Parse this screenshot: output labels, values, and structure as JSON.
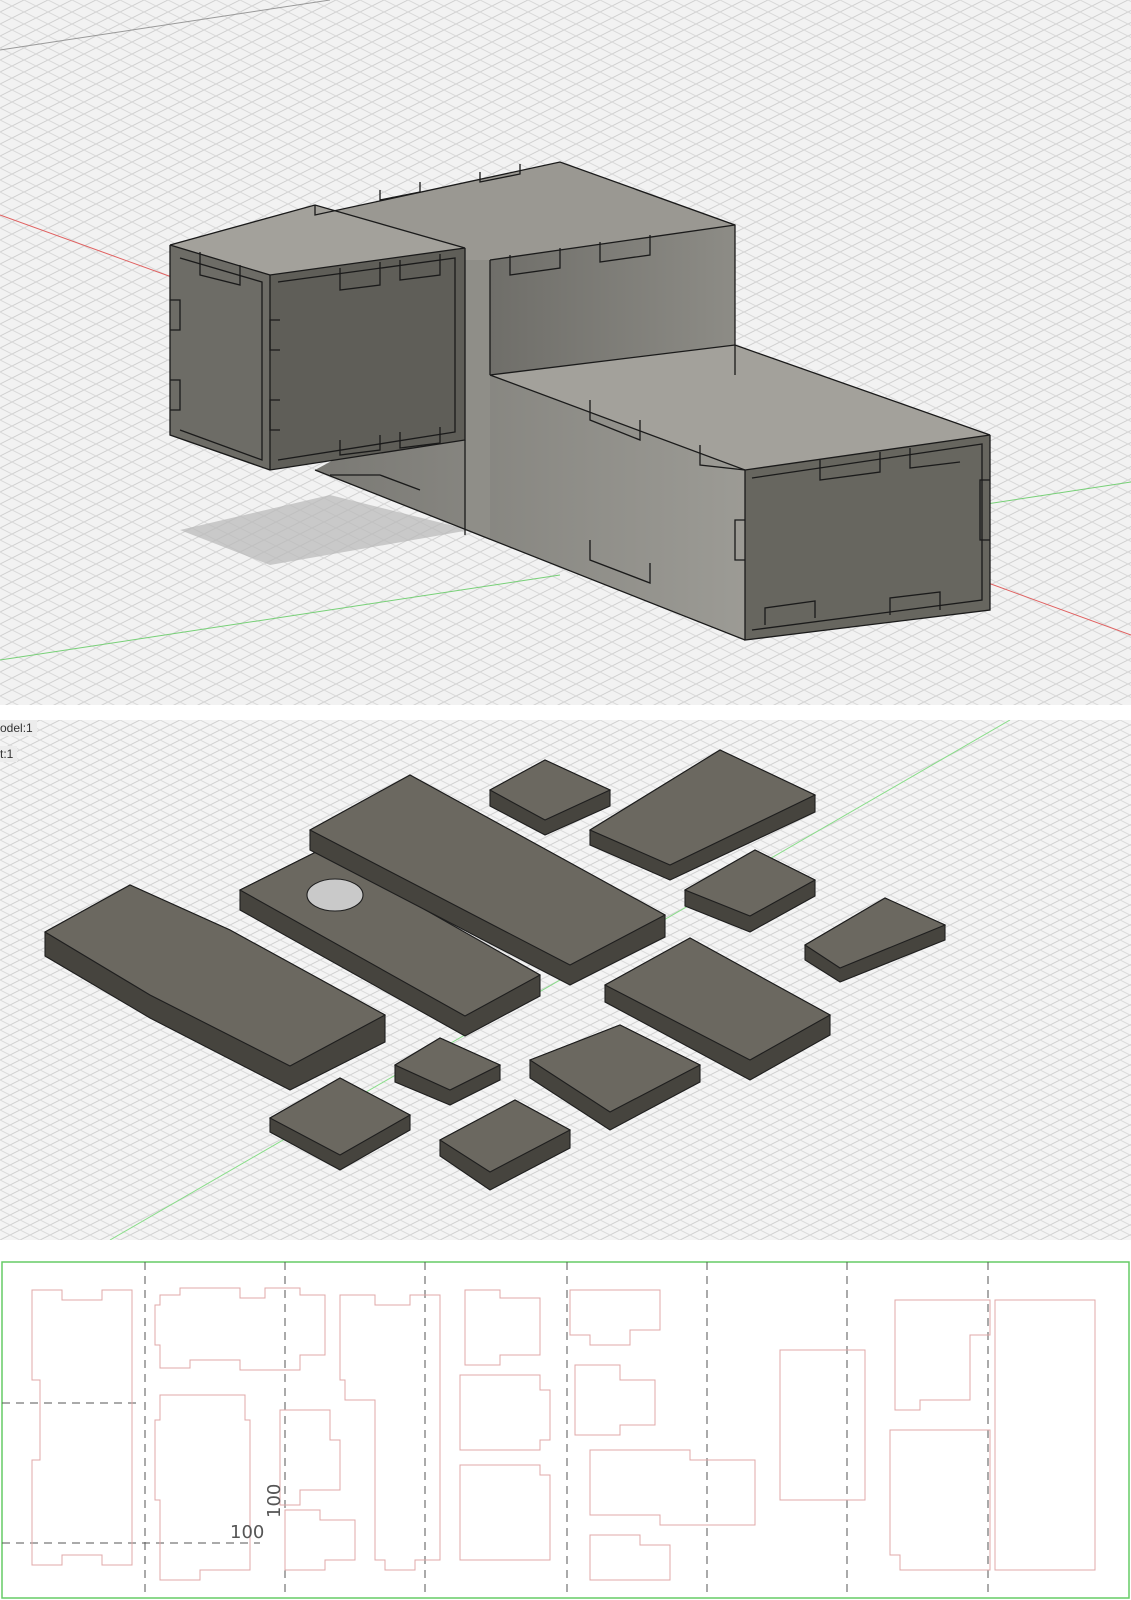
{
  "browser": {
    "model_label": "odel:1",
    "part_label": "t:1"
  },
  "flat_view": {
    "dimension_horizontal": "100",
    "dimension_vertical": "100"
  },
  "colors": {
    "body_side": "#8a8a84",
    "body_dark": "#5e5e59",
    "body_top": "#a09e98",
    "part_top": "#6b6860",
    "part_side": "#46443e",
    "cut_line": "#e0a8a8",
    "frame": "#66cc66",
    "axis_red": "#e06060",
    "axis_green": "#77d077"
  }
}
